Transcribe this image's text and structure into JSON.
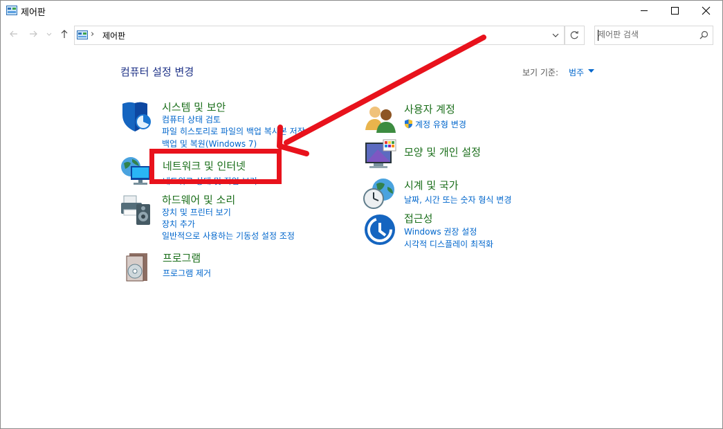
{
  "window": {
    "title": "제어판",
    "buttons": {
      "minimize": "minimize",
      "maximize": "maximize",
      "close": "close"
    }
  },
  "address": {
    "separator": "›",
    "path": "제어판"
  },
  "search": {
    "placeholder": "제어판 검색"
  },
  "main": {
    "heading": "컴퓨터 설정 변경",
    "view_by_label": "보기 기준:",
    "view_by_value": "범주"
  },
  "categories_left": [
    {
      "title": "시스템 및 보안",
      "icon": "shield-icon",
      "links": [
        "컴퓨터 상태 검토",
        "파일 히스토리로 파일의 백업 복사본 저장",
        "백업 및 복원(Windows 7)"
      ]
    },
    {
      "title": "네트워크 및 인터넷",
      "icon": "network-globe-icon",
      "links": [
        "네트워크 상태 및 작업 보기"
      ]
    },
    {
      "title": "하드웨어 및 소리",
      "icon": "printer-speaker-icon",
      "links": [
        "장치 및 프린터 보기",
        "장치 추가",
        "일반적으로 사용하는 기동성 설정 조정"
      ]
    },
    {
      "title": "프로그램",
      "icon": "program-disc-icon",
      "links": [
        "프로그램 제거"
      ]
    }
  ],
  "categories_right": [
    {
      "title": "사용자 계정",
      "icon": "users-icon",
      "links": [
        "계정 유형 변경"
      ]
    },
    {
      "title": "모양 및 개인 설정",
      "icon": "monitor-palette-icon",
      "links": []
    },
    {
      "title": "시계 및 국가",
      "icon": "clock-globe-icon",
      "links": [
        "날짜, 시간 또는 숫자 형식 변경"
      ]
    },
    {
      "title": "접근성",
      "icon": "ease-of-access-icon",
      "links": [
        "Windows 권장 설정",
        "시각적 디스플레이 최적화"
      ]
    }
  ],
  "annotation": {
    "color": "#e8121c"
  }
}
